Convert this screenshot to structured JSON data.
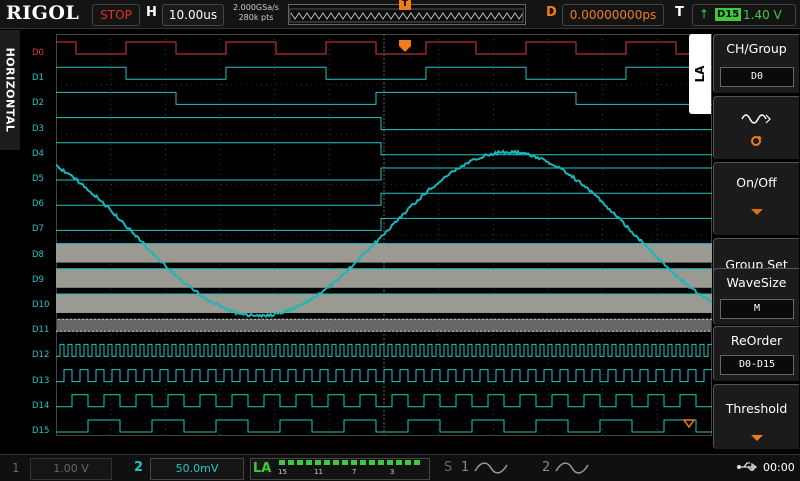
{
  "header": {
    "logo": "RIGOL",
    "run_state": "STOP",
    "horizontal_mark": "H",
    "timebase": "10.00us",
    "sample_rate": "2.000GSa/s",
    "memory_depth": "280k pts",
    "delay_mark": "D",
    "delay": "0.00000000ps",
    "trigger_mark": "T",
    "trigger_source": "D15",
    "trigger_level": "1.40 V",
    "trigger_marker": "T"
  },
  "side_tab": {
    "label": "HORIZONTAL"
  },
  "channels": [
    "D0",
    "D1",
    "D2",
    "D3",
    "D4",
    "D5",
    "D6",
    "D7",
    "D8",
    "D9",
    "D10",
    "D11",
    "D12",
    "D13",
    "D14",
    "D15"
  ],
  "menu": {
    "tab": "LA",
    "items": [
      {
        "label": "CH/Group",
        "value": "D0"
      },
      {
        "label": "",
        "value": ""
      },
      {
        "label": "On/Off",
        "value": ""
      },
      {
        "label": "Group Set",
        "value": ""
      },
      {
        "label": "WaveSize",
        "value": "M"
      },
      {
        "label": "ReOrder",
        "value": "D0-D15"
      },
      {
        "label": "Threshold",
        "value": ""
      }
    ]
  },
  "footer": {
    "ch1_num": "1",
    "ch1_scale": "1.00 V",
    "ch2_num": "2",
    "ch2_scale": "50.0mV",
    "la_label": "LA",
    "la_bits": [
      "15",
      "11",
      "7",
      "3"
    ],
    "s_label": "S",
    "bus1": "1",
    "bus2": "2",
    "time": "00:00"
  },
  "colors": {
    "digital": "#22c6c6",
    "d0": "#e03a3a",
    "analog": "#18b8b8",
    "accent": "#f07d1c",
    "grid": "#555555",
    "trigger": "#3ec93e"
  }
}
